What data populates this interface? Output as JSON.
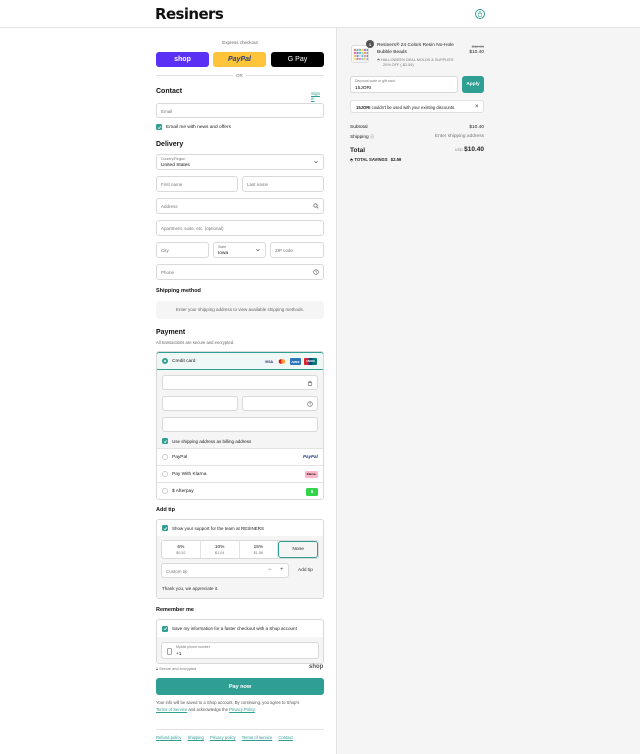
{
  "header": {
    "logo": "Resiners"
  },
  "express": {
    "title": "Express checkout",
    "shop": "shop",
    "paypal": "PayPal",
    "gpay": "G Pay",
    "or": "OR"
  },
  "contact": {
    "title": "Contact",
    "sign_in": "Sign in",
    "email_placeholder": "Email",
    "news_label": "Email me with news and offers"
  },
  "delivery": {
    "title": "Delivery",
    "country_label": "Country/Region",
    "country_value": "United States",
    "first_name": "First name",
    "last_name": "Last name",
    "address": "Address",
    "apartment": "Apartment, suite, etc. (optional)",
    "city": "City",
    "state_label": "State",
    "state_value": "Iowa",
    "zip": "ZIP code",
    "phone": "Phone"
  },
  "shipping_method": {
    "title": "Shipping method",
    "message": "Enter your shipping address to view available shipping methods."
  },
  "payment": {
    "title": "Payment",
    "subtitle": "All transactions are secure and encrypted.",
    "credit_card": "Credit card",
    "card_brands": [
      "VISA",
      "MC",
      "AMEX",
      "UNION"
    ],
    "billing_label": "Use shipping address as billing address",
    "paypal": "PayPal",
    "paypal_logo": "PayPal",
    "klarna": "Pay With Klarna",
    "klarna_logo": "Klarna.",
    "afterpay": "$ Afterpay",
    "afterpay_logo": "$"
  },
  "tip": {
    "title": "Add tip",
    "support_label": "Show your support for the team at RESINERS",
    "options": [
      {
        "pct": "5%",
        "amt": "$0.52"
      },
      {
        "pct": "10%",
        "amt": "$1.04"
      },
      {
        "pct": "15%",
        "amt": "$1.56"
      },
      {
        "pct": "None",
        "amt": ""
      }
    ],
    "custom_placeholder": "Custom tip",
    "minus": "−",
    "plus": "+",
    "add_tip": "Add tip",
    "thanks": "Thank you, we appreciate it."
  },
  "remember": {
    "title": "Remember me",
    "save_label": "Save my information for a faster checkout with a Shop account",
    "mobile_label": "Mobile phone number",
    "mobile_value": "+1"
  },
  "secure": {
    "text": "Secure and encrypted",
    "shop": "shop"
  },
  "pay_now": "Pay now",
  "legal": {
    "line1": "Your info will be saved to a Shop account. By continuing, you agree to Shop's",
    "terms": "Terms of Service",
    "and": " and acknowledge the ",
    "privacy": "Privacy Policy",
    "end": "."
  },
  "footer": [
    "Refund policy",
    "Shipping",
    "Privacy policy",
    "Terms of service",
    "Contact"
  ],
  "summary": {
    "qty": "1",
    "product_title": "Resiners® 24 Colors Resin No-Hole Bubble Beads",
    "discount_name": "HALLOWEEN DEAL MOLDS & SUPPLIES",
    "discount_note": "20% OFF (-$2.59)",
    "price_original": "$12.99",
    "price_now": "$10.40",
    "code_label": "Discount code or gift card",
    "code_value": "15JORI",
    "apply": "Apply",
    "warn_code": "15JORI",
    "warn_text": " couldn't be used with your existing discounts.",
    "close": "×",
    "subtotal_label": "Subtotal",
    "subtotal": "$10.40",
    "shipping_label": "Shipping",
    "shipping": "Enter shipping address",
    "total_label": "Total",
    "currency": "USD",
    "total": "$10.40",
    "savings_label": "TOTAL SAVINGS",
    "savings": "$2.59"
  },
  "colors": {
    "accent": "#2f9e93",
    "shop_purple": "#5a31f4",
    "paypal_yellow": "#ffc439"
  }
}
